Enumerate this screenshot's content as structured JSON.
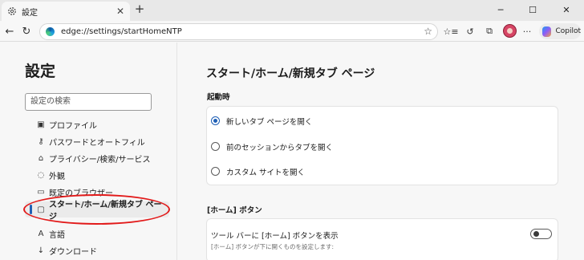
{
  "browser": {
    "tab": {
      "title": "設定",
      "icon": "gear-icon",
      "close_glyph": "✕"
    },
    "new_tab_glyph": "+",
    "window_controls": [
      {
        "name": "minimize-button",
        "glyph": "─"
      },
      {
        "name": "maximize-button",
        "glyph": "☐"
      },
      {
        "name": "close-window-button",
        "glyph": "✕"
      }
    ],
    "nav": {
      "back_glyph": "←",
      "refresh_glyph": "↻"
    },
    "address": {
      "url": "edge://settings/startHomeNTP",
      "favorite_glyph": "☆"
    },
    "toolbar": {
      "favorites_glyph": "☆≡",
      "history_glyph": "↺",
      "screenshot_glyph": "⧉",
      "more_glyph": "···",
      "copilot_label": "Copilot"
    }
  },
  "sidebar": {
    "title": "設定",
    "search_placeholder": "設定の検索",
    "items": [
      {
        "label": "プロファイル",
        "icon": "profile-icon",
        "glyph": "▣"
      },
      {
        "label": "パスワードとオートフィル",
        "icon": "key-icon",
        "glyph": "⚷"
      },
      {
        "label": "プライバシー/検索/サービス",
        "icon": "lock-icon",
        "glyph": "⌂"
      },
      {
        "label": "外観",
        "icon": "palette-icon",
        "glyph": "◌"
      },
      {
        "label": "既定のブラウザー",
        "icon": "browser-icon",
        "glyph": "▭"
      },
      {
        "label": "スタート/ホーム/新規タブ ページ",
        "icon": "home-page-icon",
        "glyph": "▢",
        "active": true
      },
      {
        "label": "言語",
        "icon": "language-icon",
        "glyph": "A"
      },
      {
        "label": "ダウンロード",
        "icon": "download-icon",
        "glyph": "↓"
      }
    ]
  },
  "main": {
    "title": "スタート/ホーム/新規タブ ページ",
    "startup": {
      "label": "起動時",
      "options": [
        {
          "label": "新しいタブ ページを開く",
          "selected": true
        },
        {
          "label": "前のセッションからタブを開く",
          "selected": false
        },
        {
          "label": "カスタム サイトを開く",
          "selected": false
        }
      ]
    },
    "home_button": {
      "label": "[ホーム] ボタン",
      "toggle_title": "ツール バーに [ホーム] ボタンを表示",
      "toggle_subtitle": "[ホーム] ボタンが下に開くものを設定します:",
      "enabled": false
    }
  },
  "colors": {
    "accent": "#1f5fb5",
    "highlight_annotation": "#e21a1a"
  }
}
